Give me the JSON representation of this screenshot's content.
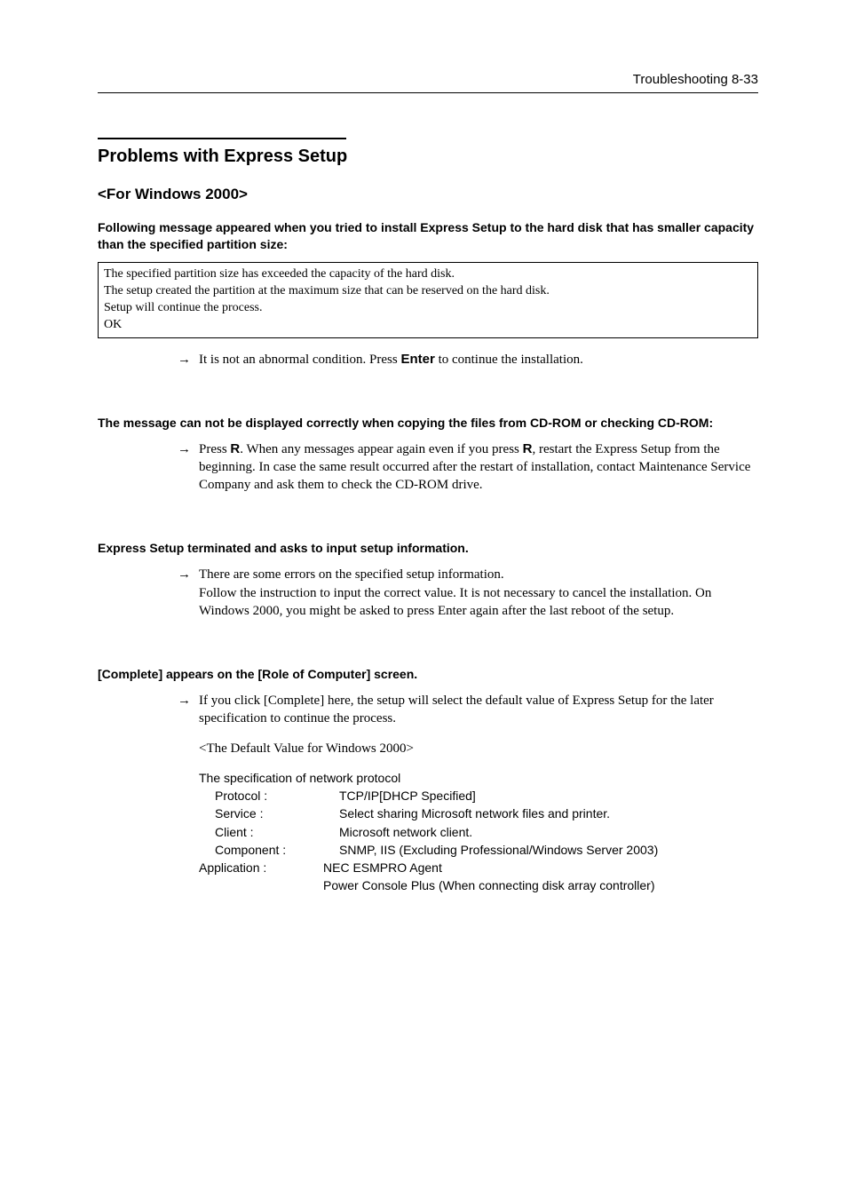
{
  "header": {
    "text": "Troubleshooting   8-33"
  },
  "section": {
    "title": "Problems with Express Setup"
  },
  "sub1": {
    "title": "<For Windows 2000>"
  },
  "q1": {
    "heading": "Following message appeared when you tried to install Express Setup to the hard disk that has smaller capacity than the specified partition size:",
    "box_line1": "The specified partition size has exceeded the capacity of the hard disk.",
    "box_line2": "The setup created the partition at the maximum size that can be reserved on the hard disk.",
    "box_line3": "Setup will continue the process.",
    "box_line4": "OK",
    "answer_pre": "It is not an abnormal condition.    Press ",
    "answer_key": "Enter",
    "answer_post": " to continue the installation."
  },
  "q2": {
    "heading": "The message can not be displayed correctly when copying the files from CD-ROM or checking CD-ROM:",
    "a_pre": "Press ",
    "a_r1": "R",
    "a_mid": ". When any messages appear again even if you press ",
    "a_r2": "R",
    "a_post": ", restart the Express Setup from the beginning.    In case the same result occurred after the restart of installation, contact Maintenance Service Company and ask them to check the CD-ROM drive."
  },
  "q3": {
    "heading": "Express Setup terminated and asks to input setup information.",
    "a_line1": "There are some errors on the specified setup information.",
    "a_line2": "Follow the instruction to input the correct value.    It is not necessary to cancel the installation.    On Windows 2000, you might be asked to press Enter again after the last reboot of the setup."
  },
  "q4": {
    "heading": "[Complete] appears on the [Role of Computer] screen.",
    "a_line": "If you click [Complete] here, the setup will select the default value of Express Setup for the later specification to continue the process.",
    "default_intro": "<The Default Value for Windows 2000>",
    "spec_title": "The specification of network protocol",
    "rows": {
      "protocol_l": "Protocol :",
      "protocol_v": "TCP/IP[DHCP Specified]",
      "service_l": "Service :",
      "service_v": "Select sharing Microsoft network files and printer.",
      "client_l": "Client :",
      "client_v": "Microsoft network client.",
      "component_l": "Component :",
      "component_v": "SNMP, IIS (Excluding Professional/Windows Server 2003)",
      "app_l": "Application :",
      "app_v": "NEC ESMPRO Agent",
      "app_v2": "Power Console Plus (When connecting disk array controller)"
    }
  }
}
